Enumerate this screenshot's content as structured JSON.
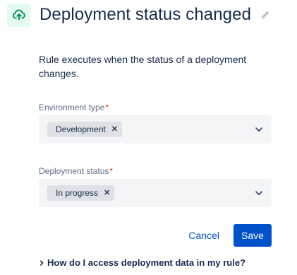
{
  "header": {
    "icon": "cloud-upload-icon",
    "title": "Deployment status changed",
    "edit_icon": "pencil-icon"
  },
  "description": "Rule executes when the status of a deployment changes.",
  "fields": [
    {
      "label": "Environment type",
      "required_marker": "*",
      "selected": "Development",
      "remove_icon": "close-icon",
      "dropdown_icon": "chevron-down-icon"
    },
    {
      "label": "Deployment status",
      "required_marker": "*",
      "selected": "In progress",
      "remove_icon": "close-icon",
      "dropdown_icon": "chevron-down-icon"
    }
  ],
  "actions": {
    "cancel_label": "Cancel",
    "save_label": "Save"
  },
  "help": {
    "icon": "chevron-right-icon",
    "label": "How do I access deployment data in my rule?"
  },
  "colors": {
    "accent": "#0052cc",
    "icon_green": "#00875a",
    "icon_bg": "#e3fcef",
    "required": "#de350b"
  }
}
